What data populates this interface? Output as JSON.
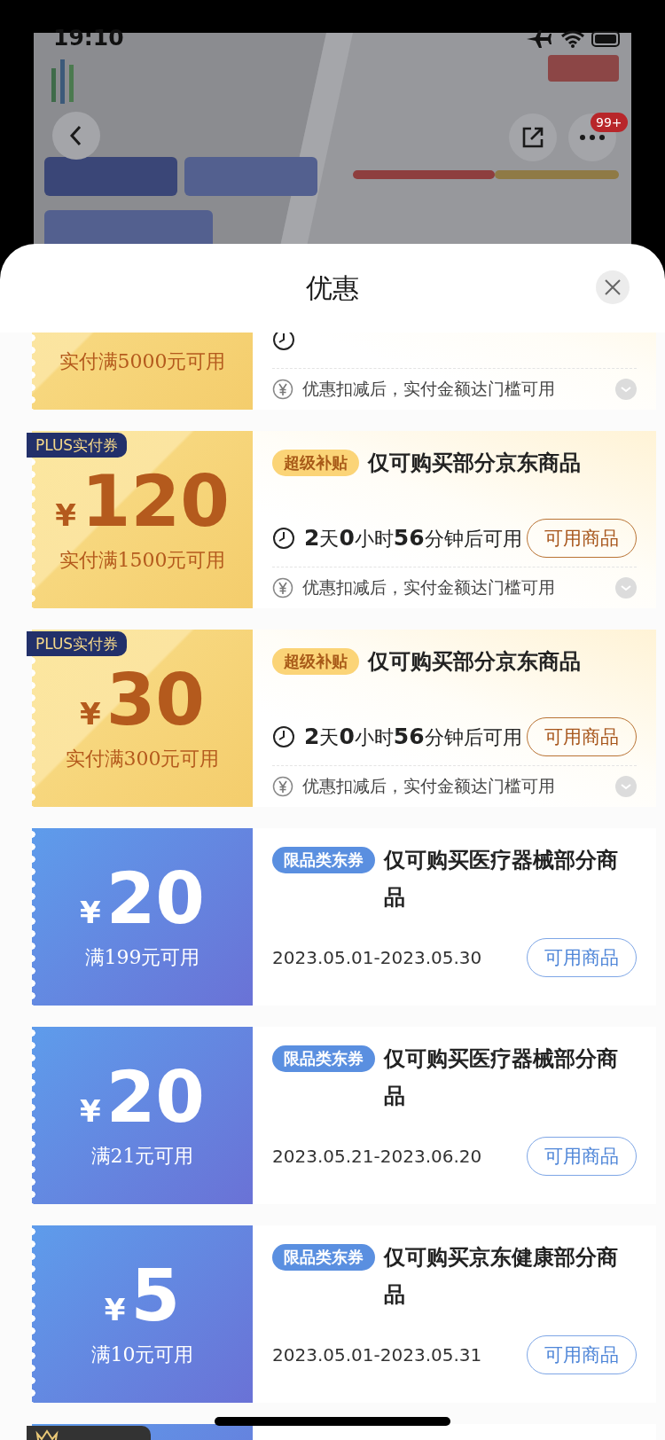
{
  "status_bar": {
    "time": "19:10"
  },
  "nav": {
    "more_badge": "99+"
  },
  "sheet": {
    "title": "优惠"
  },
  "coupons": [
    {
      "kind": "plus",
      "condition": "实付满5000元可用",
      "note": "优惠扣减后，实付金额达门槛可用"
    },
    {
      "kind": "plus",
      "badge": "PLUS实付券",
      "currency": "¥",
      "amount": "120",
      "condition": "实付满1500元可用",
      "tag": "超级补贴",
      "title": "仅可购买部分京东商品",
      "countdown": "**2**天**0**小时**56**分钟后可用",
      "button": "可用商品",
      "note": "优惠扣减后，实付金额达门槛可用"
    },
    {
      "kind": "plus",
      "badge": "PLUS实付券",
      "currency": "¥",
      "amount": "30",
      "condition": "实付满300元可用",
      "tag": "超级补贴",
      "title": "仅可购买部分京东商品",
      "countdown": "**2**天**0**小时**56**分钟后可用",
      "button": "可用商品",
      "note": "优惠扣减后，实付金额达门槛可用"
    },
    {
      "kind": "category",
      "currency": "¥",
      "amount": "20",
      "condition": "满199元可用",
      "tag": "限品类东券",
      "title": "仅可购买医疗器械部分商品",
      "validity": "2023.05.01-2023.05.30",
      "button": "可用商品"
    },
    {
      "kind": "category",
      "currency": "¥",
      "amount": "20",
      "condition": "满21元可用",
      "tag": "限品类东券",
      "title": "仅可购买医疗器械部分商品",
      "validity": "2023.05.21-2023.06.20",
      "button": "可用商品"
    },
    {
      "kind": "category",
      "currency": "¥",
      "amount": "5",
      "condition": "满10元可用",
      "tag": "限品类东券",
      "title": "仅可购买京东健康部分商品",
      "validity": "2023.05.01-2023.05.31",
      "button": "可用商品"
    },
    {
      "kind": "member"
    }
  ]
}
